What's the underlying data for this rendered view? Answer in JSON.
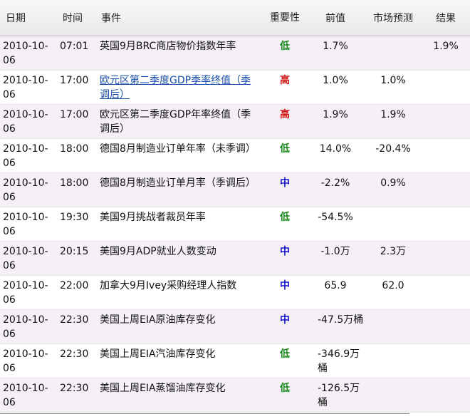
{
  "headers": {
    "date": "日期",
    "time": "时间",
    "event": "事件",
    "importance": "重要性",
    "previous": "前值",
    "forecast": "市场预测",
    "result": "结果"
  },
  "rows": [
    {
      "date": "2010-10-06",
      "time": "07:01",
      "event": "英国9月BRC商店物价指数年率",
      "importance": "低",
      "level": "low",
      "previous": "1.7%",
      "forecast": "",
      "result": "1.9%",
      "link": false
    },
    {
      "date": "2010-10-06",
      "time": "17:00",
      "event": "欧元区第二季度GDP季率终值（季调后）",
      "importance": "高",
      "level": "high",
      "previous": "1.0%",
      "forecast": "1.0%",
      "result": "",
      "link": true
    },
    {
      "date": "2010-10-06",
      "time": "17:00",
      "event": "欧元区第二季度GDP年率终值（季调后）",
      "importance": "高",
      "level": "high",
      "previous": "1.9%",
      "forecast": "1.9%",
      "result": "",
      "link": false
    },
    {
      "date": "2010-10-06",
      "time": "18:00",
      "event": "德国8月制造业订单年率（未季调）",
      "importance": "低",
      "level": "low",
      "previous": "14.0%",
      "forecast": "-20.4%",
      "result": "",
      "link": false
    },
    {
      "date": "2010-10-06",
      "time": "18:00",
      "event": "德国8月制造业订单月率（季调后）",
      "importance": "中",
      "level": "mid",
      "previous": "-2.2%",
      "forecast": "0.9%",
      "result": "",
      "link": false
    },
    {
      "date": "2010-10-06",
      "time": "19:30",
      "event": "美国9月挑战者裁员年率",
      "importance": "低",
      "level": "low",
      "previous": "-54.5%",
      "forecast": "",
      "result": "",
      "link": false
    },
    {
      "date": "2010-10-06",
      "time": "20:15",
      "event": "美国9月ADP就业人数变动",
      "importance": "中",
      "level": "mid",
      "previous": "-1.0万",
      "forecast": "2.3万",
      "result": "",
      "link": false
    },
    {
      "date": "2010-10-06",
      "time": "22:00",
      "event": "加拿大9月Ivey采购经理人指数",
      "importance": "中",
      "level": "mid",
      "previous": "65.9",
      "forecast": "62.0",
      "result": "",
      "link": false
    },
    {
      "date": "2010-10-06",
      "time": "22:30",
      "event": "美国上周EIA原油库存变化",
      "importance": "中",
      "level": "mid",
      "previous": "-47.5万桶",
      "forecast": "",
      "result": "",
      "link": false
    },
    {
      "date": "2010-10-06",
      "time": "22:30",
      "event": "美国上周EIA汽油库存变化",
      "importance": "低",
      "level": "low",
      "previous": "-346.9万桶",
      "forecast": "",
      "result": "",
      "link": false
    },
    {
      "date": "2010-10-06",
      "time": "22:30",
      "event": "美国上周EIA蒸馏油库存变化",
      "importance": "低",
      "level": "low",
      "previous": "-126.5万桶",
      "forecast": "",
      "result": "",
      "link": false
    }
  ],
  "colors": {
    "low": "#1a8a1a",
    "mid": "#1515c8",
    "high": "#d01010",
    "link": "#1a4fa8",
    "row_alt": "#f4f0f6"
  }
}
